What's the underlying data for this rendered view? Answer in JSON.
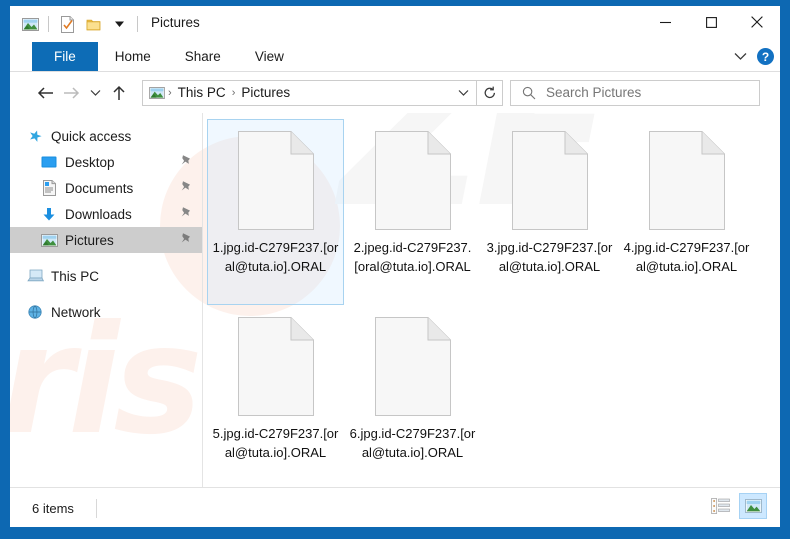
{
  "window": {
    "title": "Pictures",
    "quick_access_toolbar": [
      {
        "name": "pictures-icon",
        "label": "Pictures"
      },
      {
        "name": "properties-icon",
        "label": "Properties"
      },
      {
        "name": "new-folder-icon",
        "label": "New folder"
      },
      {
        "name": "customize-qat-icon",
        "label": "Customize Quick Access Toolbar"
      }
    ],
    "controls": {
      "minimize": "—",
      "maximize": "□",
      "close": "✕"
    }
  },
  "ribbon": {
    "tabs": [
      {
        "label": "File",
        "active": true
      },
      {
        "label": "Home",
        "active": false
      },
      {
        "label": "Share",
        "active": false
      },
      {
        "label": "View",
        "active": false
      }
    ],
    "expand_label": "⌄",
    "help_label": "?"
  },
  "navigation": {
    "back": "←",
    "forward": "→",
    "recent": "⌄",
    "up": "↑",
    "breadcrumb_icon": "pictures-icon",
    "breadcrumb": [
      "This PC",
      "Pictures"
    ],
    "separator": "›",
    "dropdown": "⌄",
    "refresh": "↻"
  },
  "search": {
    "placeholder": "Search Pictures",
    "value": "",
    "icon": "search-icon"
  },
  "sidebar": {
    "items": [
      {
        "label": "Quick access",
        "icon": "star-icon",
        "indent": false,
        "pinned": false,
        "selected": false
      },
      {
        "label": "Desktop",
        "icon": "desktop-icon",
        "indent": true,
        "pinned": true,
        "selected": false
      },
      {
        "label": "Documents",
        "icon": "document-icon",
        "indent": true,
        "pinned": true,
        "selected": false
      },
      {
        "label": "Downloads",
        "icon": "download-icon",
        "indent": true,
        "pinned": true,
        "selected": false
      },
      {
        "label": "Pictures",
        "icon": "pictures-icon",
        "indent": true,
        "pinned": true,
        "selected": true
      },
      {
        "label": "This PC",
        "icon": "thispc-icon",
        "indent": false,
        "pinned": false,
        "selected": false
      },
      {
        "label": "Network",
        "icon": "network-icon",
        "indent": false,
        "pinned": false,
        "selected": false
      }
    ]
  },
  "files": [
    {
      "name": "1.jpg.id-C279F237.[oral@tuta.io].ORAL",
      "icon": "generic-file-icon",
      "selected": true
    },
    {
      "name": "2.jpeg.id-C279F237.[oral@tuta.io].ORAL",
      "icon": "generic-file-icon",
      "selected": false
    },
    {
      "name": "3.jpg.id-C279F237.[oral@tuta.io].ORAL",
      "icon": "generic-file-icon",
      "selected": false
    },
    {
      "name": "4.jpg.id-C279F237.[oral@tuta.io].ORAL",
      "icon": "generic-file-icon",
      "selected": false
    },
    {
      "name": "5.jpg.id-C279F237.[oral@tuta.io].ORAL",
      "icon": "generic-file-icon",
      "selected": false
    },
    {
      "name": "6.jpg.id-C279F237.[oral@tuta.io].ORAL",
      "icon": "generic-file-icon",
      "selected": false
    }
  ],
  "status": {
    "item_count": "6 items",
    "views": [
      {
        "name": "details-view-button",
        "active": false
      },
      {
        "name": "large-icons-view-button",
        "active": true
      }
    ]
  },
  "watermark": {
    "text": "ris",
    "text2": "ZE"
  },
  "colors": {
    "accent": "#0d6cb6",
    "desktop": "#0d68b2",
    "selection": "#cde8ff",
    "selection_border": "#a8d3f0",
    "sidebar_selected": "#cdcdcd",
    "help_blue": "#1271c2"
  }
}
